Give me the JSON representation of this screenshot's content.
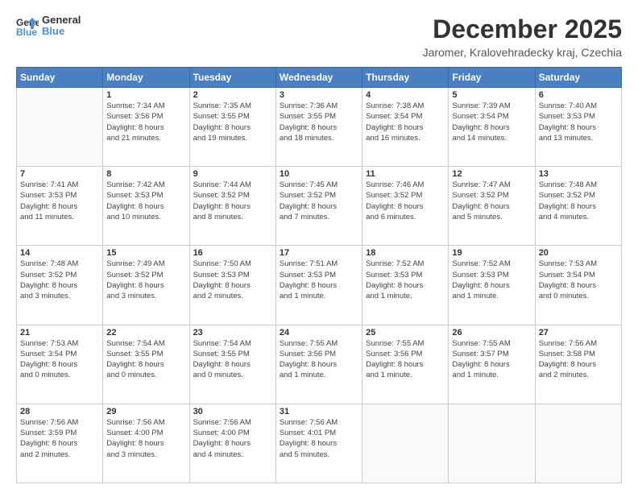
{
  "header": {
    "logo_line1": "General",
    "logo_line2": "Blue",
    "title": "December 2025",
    "subtitle": "Jaromer, Kralovehradecky kraj, Czechia"
  },
  "weekdays": [
    "Sunday",
    "Monday",
    "Tuesday",
    "Wednesday",
    "Thursday",
    "Friday",
    "Saturday"
  ],
  "weeks": [
    [
      {
        "day": "",
        "info": ""
      },
      {
        "day": "1",
        "info": "Sunrise: 7:34 AM\nSunset: 3:56 PM\nDaylight: 8 hours\nand 21 minutes."
      },
      {
        "day": "2",
        "info": "Sunrise: 7:35 AM\nSunset: 3:55 PM\nDaylight: 8 hours\nand 19 minutes."
      },
      {
        "day": "3",
        "info": "Sunrise: 7:36 AM\nSunset: 3:55 PM\nDaylight: 8 hours\nand 18 minutes."
      },
      {
        "day": "4",
        "info": "Sunrise: 7:38 AM\nSunset: 3:54 PM\nDaylight: 8 hours\nand 16 minutes."
      },
      {
        "day": "5",
        "info": "Sunrise: 7:39 AM\nSunset: 3:54 PM\nDaylight: 8 hours\nand 14 minutes."
      },
      {
        "day": "6",
        "info": "Sunrise: 7:40 AM\nSunset: 3:53 PM\nDaylight: 8 hours\nand 13 minutes."
      }
    ],
    [
      {
        "day": "7",
        "info": "Sunrise: 7:41 AM\nSunset: 3:53 PM\nDaylight: 8 hours\nand 11 minutes."
      },
      {
        "day": "8",
        "info": "Sunrise: 7:42 AM\nSunset: 3:53 PM\nDaylight: 8 hours\nand 10 minutes."
      },
      {
        "day": "9",
        "info": "Sunrise: 7:44 AM\nSunset: 3:52 PM\nDaylight: 8 hours\nand 8 minutes."
      },
      {
        "day": "10",
        "info": "Sunrise: 7:45 AM\nSunset: 3:52 PM\nDaylight: 8 hours\nand 7 minutes."
      },
      {
        "day": "11",
        "info": "Sunrise: 7:46 AM\nSunset: 3:52 PM\nDaylight: 8 hours\nand 6 minutes."
      },
      {
        "day": "12",
        "info": "Sunrise: 7:47 AM\nSunset: 3:52 PM\nDaylight: 8 hours\nand 5 minutes."
      },
      {
        "day": "13",
        "info": "Sunrise: 7:48 AM\nSunset: 3:52 PM\nDaylight: 8 hours\nand 4 minutes."
      }
    ],
    [
      {
        "day": "14",
        "info": "Sunrise: 7:48 AM\nSunset: 3:52 PM\nDaylight: 8 hours\nand 3 minutes."
      },
      {
        "day": "15",
        "info": "Sunrise: 7:49 AM\nSunset: 3:52 PM\nDaylight: 8 hours\nand 3 minutes."
      },
      {
        "day": "16",
        "info": "Sunrise: 7:50 AM\nSunset: 3:53 PM\nDaylight: 8 hours\nand 2 minutes."
      },
      {
        "day": "17",
        "info": "Sunrise: 7:51 AM\nSunset: 3:53 PM\nDaylight: 8 hours\nand 1 minute."
      },
      {
        "day": "18",
        "info": "Sunrise: 7:52 AM\nSunset: 3:53 PM\nDaylight: 8 hours\nand 1 minute."
      },
      {
        "day": "19",
        "info": "Sunrise: 7:52 AM\nSunset: 3:53 PM\nDaylight: 8 hours\nand 1 minute."
      },
      {
        "day": "20",
        "info": "Sunrise: 7:53 AM\nSunset: 3:54 PM\nDaylight: 8 hours\nand 0 minutes."
      }
    ],
    [
      {
        "day": "21",
        "info": "Sunrise: 7:53 AM\nSunset: 3:54 PM\nDaylight: 8 hours\nand 0 minutes."
      },
      {
        "day": "22",
        "info": "Sunrise: 7:54 AM\nSunset: 3:55 PM\nDaylight: 8 hours\nand 0 minutes."
      },
      {
        "day": "23",
        "info": "Sunrise: 7:54 AM\nSunset: 3:55 PM\nDaylight: 8 hours\nand 0 minutes."
      },
      {
        "day": "24",
        "info": "Sunrise: 7:55 AM\nSunset: 3:56 PM\nDaylight: 8 hours\nand 1 minute."
      },
      {
        "day": "25",
        "info": "Sunrise: 7:55 AM\nSunset: 3:56 PM\nDaylight: 8 hours\nand 1 minute."
      },
      {
        "day": "26",
        "info": "Sunrise: 7:55 AM\nSunset: 3:57 PM\nDaylight: 8 hours\nand 1 minute."
      },
      {
        "day": "27",
        "info": "Sunrise: 7:56 AM\nSunset: 3:58 PM\nDaylight: 8 hours\nand 2 minutes."
      }
    ],
    [
      {
        "day": "28",
        "info": "Sunrise: 7:56 AM\nSunset: 3:59 PM\nDaylight: 8 hours\nand 2 minutes."
      },
      {
        "day": "29",
        "info": "Sunrise: 7:56 AM\nSunset: 4:00 PM\nDaylight: 8 hours\nand 3 minutes."
      },
      {
        "day": "30",
        "info": "Sunrise: 7:56 AM\nSunset: 4:00 PM\nDaylight: 8 hours\nand 4 minutes."
      },
      {
        "day": "31",
        "info": "Sunrise: 7:56 AM\nSunset: 4:01 PM\nDaylight: 8 hours\nand 5 minutes."
      },
      {
        "day": "",
        "info": ""
      },
      {
        "day": "",
        "info": ""
      },
      {
        "day": "",
        "info": ""
      }
    ]
  ]
}
